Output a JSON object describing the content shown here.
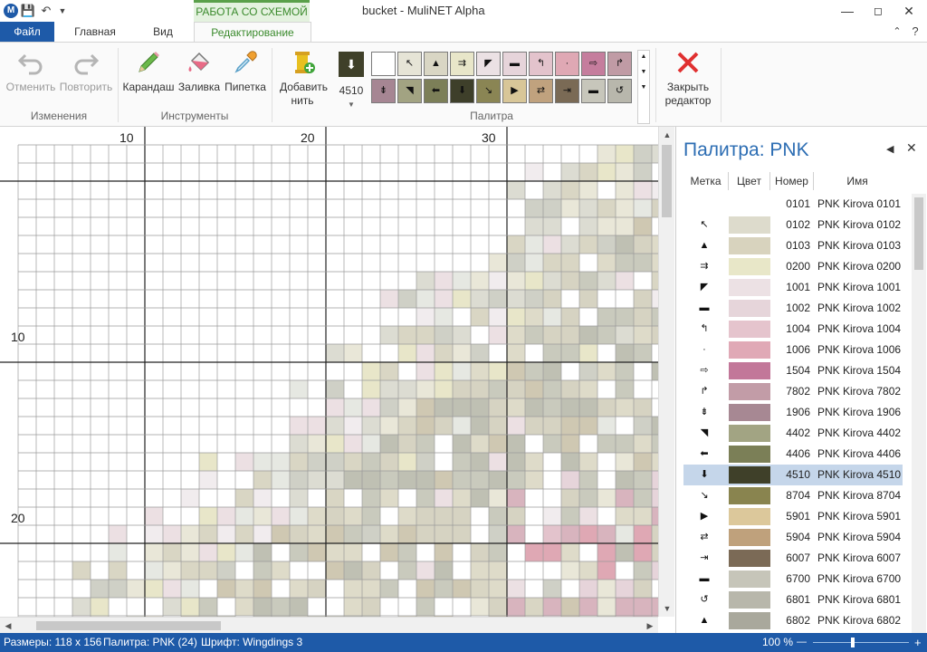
{
  "window": {
    "title": "bucket - MuliNET Alpha",
    "context_tab": "РАБОТА СО СХЕМОЙ",
    "app_icon_letter": "M"
  },
  "tabs": [
    {
      "label": "Файл",
      "active": false
    },
    {
      "label": "Главная",
      "active": false
    },
    {
      "label": "Вид",
      "active": false
    },
    {
      "label": "Редактирование",
      "active": true
    }
  ],
  "ribbon": {
    "undo": "Отменить",
    "redo": "Повторить",
    "group_changes": "Изменения",
    "pencil": "Карандаш",
    "fill": "Заливка",
    "eyedropper": "Пипетка",
    "group_tools": "Инструменты",
    "add_thread": "Добавить нить",
    "current_thread": "4510",
    "group_palette": "Палитра",
    "close_editor": "Закрыть редактор"
  },
  "ribbon_palette": [
    {
      "sym": "",
      "color": "#ffffff"
    },
    {
      "sym": "↖",
      "color": "#e6e4d6"
    },
    {
      "sym": "▲",
      "color": "#d9d6c4"
    },
    {
      "sym": "⇉",
      "color": "#e8e6c9"
    },
    {
      "sym": "◤",
      "color": "#ebe1e4"
    },
    {
      "sym": "▬",
      "color": "#e6d4da"
    },
    {
      "sym": "↰",
      "color": "#e3c3cc"
    },
    {
      "sym": "·",
      "color": "#dfa8b4"
    },
    {
      "sym": "⇨",
      "color": "#c57d9d"
    },
    {
      "sym": "↱",
      "color": "#c09ba5"
    },
    {
      "sym": "⇟",
      "color": "#a68693"
    },
    {
      "sym": "◥",
      "color": "#a2a382"
    },
    {
      "sym": "⬅",
      "color": "#7c7f58"
    },
    {
      "sym": "⬇",
      "color": "#3e3f2a"
    },
    {
      "sym": "↘",
      "color": "#8a8554"
    },
    {
      "sym": "▶",
      "color": "#d8c698"
    },
    {
      "sym": "⇄",
      "color": "#c0a27e"
    },
    {
      "sym": "⇥",
      "color": "#7a6a55"
    },
    {
      "sym": "▬",
      "color": "#c7c6bb"
    },
    {
      "sym": "↺",
      "color": "#b8b7ac"
    }
  ],
  "canvas": {
    "ruler_top": [
      "10",
      "20",
      "30"
    ],
    "ruler_left": [
      "10",
      "20"
    ]
  },
  "panel": {
    "title": "Палитра: PNK",
    "col_mark": "Метка",
    "col_color": "Цвет",
    "col_number": "Номер",
    "col_name": "Имя",
    "rows": [
      {
        "sym": "",
        "color": "#ffffff",
        "num": "0101",
        "name": "PNK Kirova 0101",
        "selected": false
      },
      {
        "sym": "↖",
        "color": "#dddbcc",
        "num": "0102",
        "name": "PNK Kirova 0102",
        "selected": false
      },
      {
        "sym": "▲",
        "color": "#d8d3be",
        "num": "0103",
        "name": "PNK Kirova 0103",
        "selected": false
      },
      {
        "sym": "⇉",
        "color": "#e8e7c8",
        "num": "0200",
        "name": "PNK Kirova 0200",
        "selected": false
      },
      {
        "sym": "◤",
        "color": "#ece1e4",
        "num": "1001",
        "name": "PNK Kirova 1001",
        "selected": false
      },
      {
        "sym": "▬",
        "color": "#e6d5da",
        "num": "1002",
        "name": "PNK Kirova 1002",
        "selected": false
      },
      {
        "sym": "↰",
        "color": "#e5c4cd",
        "num": "1004",
        "name": "PNK Kirova 1004",
        "selected": false
      },
      {
        "sym": "·",
        "color": "#e0a9b6",
        "num": "1006",
        "name": "PNK Kirova 1006",
        "selected": false
      },
      {
        "sym": "⇨",
        "color": "#c27799",
        "num": "1504",
        "name": "PNK Kirova 1504",
        "selected": false
      },
      {
        "sym": "↱",
        "color": "#c29ca7",
        "num": "7802",
        "name": "PNK Kirova 7802",
        "selected": false
      },
      {
        "sym": "⇟",
        "color": "#a78893",
        "num": "1906",
        "name": "PNK Kirova 1906",
        "selected": false
      },
      {
        "sym": "◥",
        "color": "#a2a483",
        "num": "4402",
        "name": "PNK Kirova 4402",
        "selected": false
      },
      {
        "sym": "⬅",
        "color": "#7b7f57",
        "num": "4406",
        "name": "PNK Kirova 4406",
        "selected": false
      },
      {
        "sym": "⬇",
        "color": "#3f4029",
        "num": "4510",
        "name": "PNK Kirova 4510",
        "selected": true
      },
      {
        "sym": "↘",
        "color": "#89844f",
        "num": "8704",
        "name": "PNK Kirova 8704",
        "selected": false
      },
      {
        "sym": "▶",
        "color": "#dcc89b",
        "num": "5901",
        "name": "PNK Kirova 5901",
        "selected": false
      },
      {
        "sym": "⇄",
        "color": "#bfa17c",
        "num": "5904",
        "name": "PNK Kirova 5904",
        "selected": false
      },
      {
        "sym": "⇥",
        "color": "#7b6a56",
        "num": "6007",
        "name": "PNK Kirova 6007",
        "selected": false
      },
      {
        "sym": "▬",
        "color": "#c6c5b9",
        "num": "6700",
        "name": "PNK Kirova 6700",
        "selected": false
      },
      {
        "sym": "↺",
        "color": "#b8b7ab",
        "num": "6801",
        "name": "PNK Kirova 6801",
        "selected": false
      },
      {
        "sym": "▲",
        "color": "#a9a89c",
        "num": "6802",
        "name": "PNK Kirova 6802",
        "selected": false
      }
    ]
  },
  "status": {
    "sizes": "Размеры: 118 x 156",
    "palette": "Палитра: PNK (24)",
    "font": "Шрифт: Wingdings 3",
    "zoom": "100 %"
  },
  "colors": {
    "accent": "#1e5aa8",
    "context_green": "#3a8a2c"
  }
}
